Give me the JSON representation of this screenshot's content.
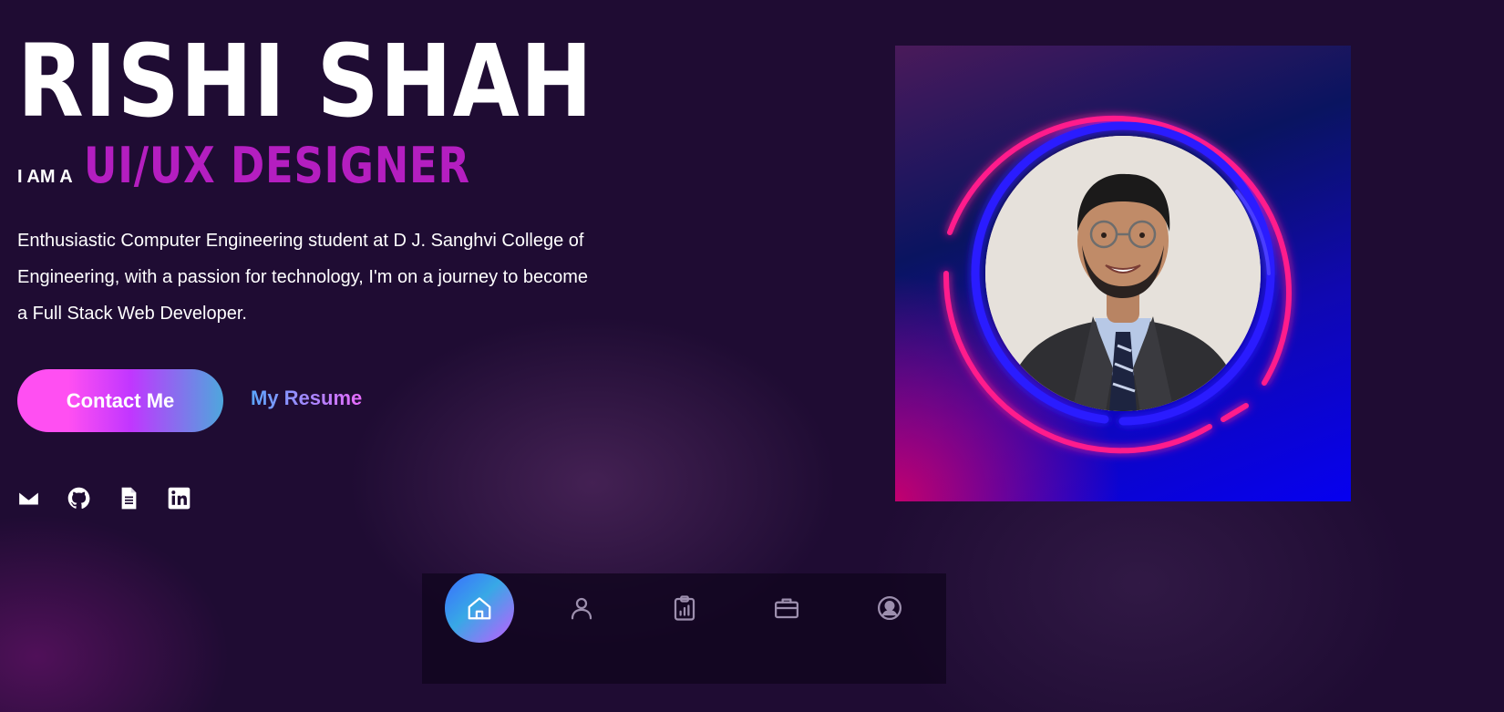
{
  "hero": {
    "name": "RISHI SHAH",
    "role_prefix": "I AM A",
    "role_title": "UI/UX DESIGNER",
    "intro": "Enthusiastic Computer Engineering student at D J. Sanghvi College of Engineering, with a passion for technology, I'm on a journey to become a Full Stack Web Developer."
  },
  "actions": {
    "contact_label": "Contact Me",
    "resume_label": "My Resume"
  },
  "socials": [
    {
      "icon": "envelope-icon"
    },
    {
      "icon": "github-icon"
    },
    {
      "icon": "document-icon"
    },
    {
      "icon": "linkedin-icon"
    }
  ],
  "nav": {
    "items": [
      {
        "icon": "home-icon",
        "active": true
      },
      {
        "icon": "user-icon",
        "active": false
      },
      {
        "icon": "clipboard-chart-icon",
        "active": false
      },
      {
        "icon": "briefcase-icon",
        "active": false
      },
      {
        "icon": "profile-circle-icon",
        "active": false
      }
    ]
  },
  "colors": {
    "background": "#1f0c33",
    "accent_title": "#b41ec0",
    "button_gradient": [
      "#ff4ff2",
      "#c136ff",
      "#4ea7dd"
    ],
    "ring_pink": "#ff1a8c",
    "ring_blue": "#2a1bff"
  }
}
